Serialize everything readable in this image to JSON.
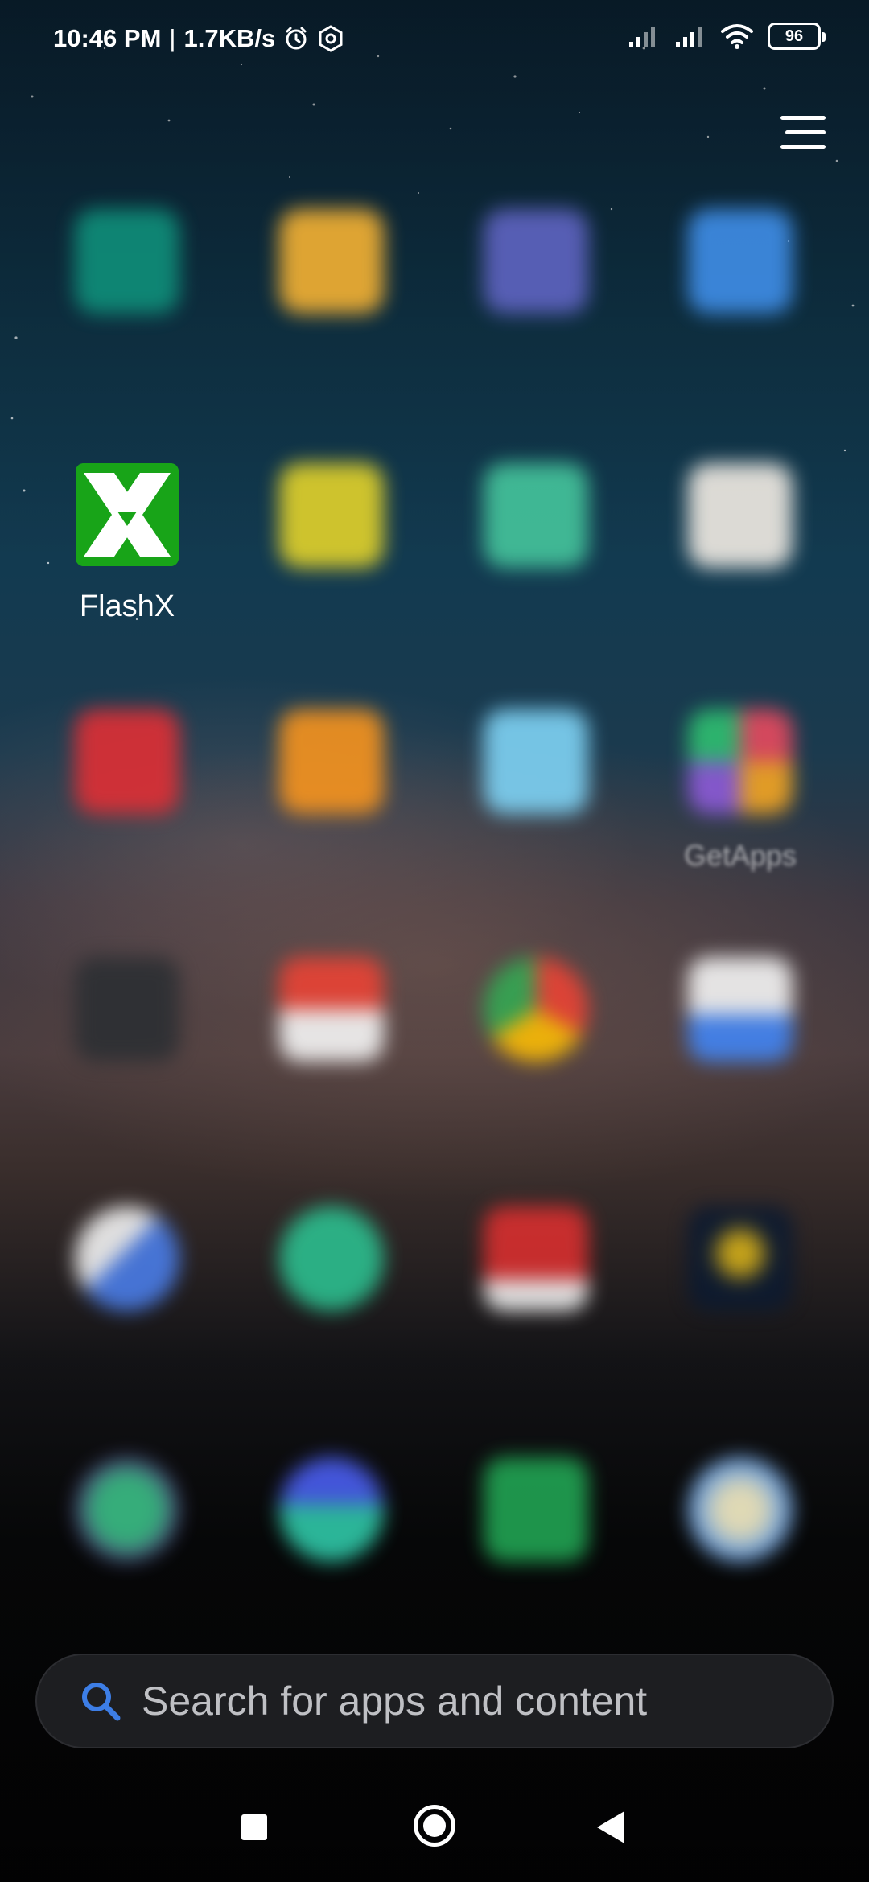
{
  "status_bar": {
    "time": "10:46 PM",
    "separator": "|",
    "network_speed": "1.7KB/s",
    "icons": [
      "alarm-icon",
      "settings-hex-icon",
      "signal-icon-1",
      "signal-icon-2",
      "wifi-icon"
    ],
    "battery_level": "96"
  },
  "menu": {
    "icon": "hamburger-menu-icon"
  },
  "apps": [
    {
      "label": "",
      "color": "#0f8f7a"
    },
    {
      "label": "",
      "color": "#f5b233"
    },
    {
      "label": "",
      "color": "#5f64c2"
    },
    {
      "label": "",
      "color": "#3f8ee8"
    },
    {
      "label": "FlashX",
      "color": "#1aa71a"
    },
    {
      "label": "",
      "color": "#e3d32a"
    },
    {
      "label": "",
      "color": "#45c59c"
    },
    {
      "label": "",
      "color": "#f2ece4"
    },
    {
      "label": "",
      "color": "#df2f35"
    },
    {
      "label": "",
      "color": "#f7941e"
    },
    {
      "label": "",
      "color": "#7fd3f5"
    },
    {
      "label": "GetApps",
      "color": "#e84a5f"
    },
    {
      "label": "",
      "color": "#2c2f33"
    },
    {
      "label": "",
      "color": "#ea4335"
    },
    {
      "label": "",
      "color": "#fbbc05"
    },
    {
      "label": "",
      "color": "#4285f4"
    },
    {
      "label": "",
      "color": "#4a7de8"
    },
    {
      "label": "",
      "color": "#2cbf8f"
    },
    {
      "label": "",
      "color": "#d82f2f"
    },
    {
      "label": "",
      "color": "#0c1a30"
    },
    {
      "label": "",
      "color": "#3bbf87"
    },
    {
      "label": "",
      "color": "#2fc8a8"
    },
    {
      "label": "",
      "color": "#21a453"
    },
    {
      "label": "",
      "color": "#7ab0f0"
    }
  ],
  "search": {
    "placeholder": "Search for apps and content",
    "icon": "search-icon"
  },
  "nav_bar": {
    "icons": [
      "recents-icon",
      "home-icon",
      "back-icon"
    ]
  },
  "colors": {
    "accent": "#3d7ee6",
    "search_bg": "#1d1e21"
  }
}
